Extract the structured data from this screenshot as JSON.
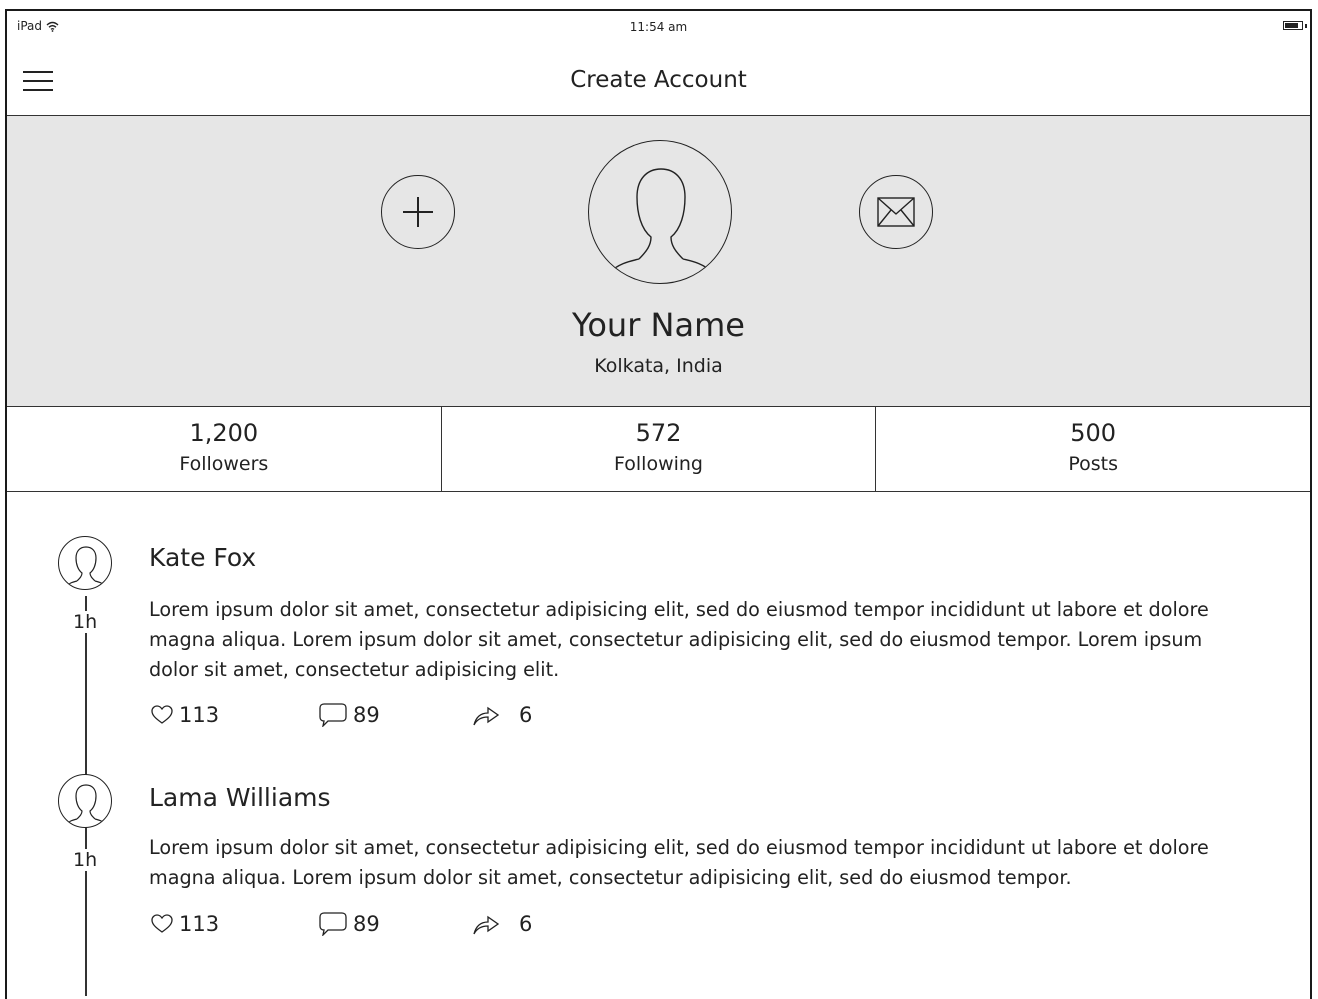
{
  "status_bar": {
    "device": "iPad",
    "time": "11:54 am"
  },
  "nav": {
    "title": "Create Account"
  },
  "profile": {
    "name": "Your Name",
    "location": "Kolkata, India"
  },
  "stats": [
    {
      "value": "1,200",
      "label": "Followers"
    },
    {
      "value": "572",
      "label": "Following"
    },
    {
      "value": "500",
      "label": "Posts"
    }
  ],
  "posts": [
    {
      "name": "Kate Fox",
      "time": "1h",
      "body": "Lorem ipsum dolor sit amet, consectetur adipisicing elit, sed do eiusmod tempor incididunt ut labore et dolore magna aliqua. Lorem ipsum dolor sit amet, consectetur adipisicing elit, sed do eiusmod tempor. Lorem ipsum dolor sit amet, consectetur adipisicing elit.",
      "likes": "113",
      "comments": "89",
      "shares": "6"
    },
    {
      "name": "Lama Williams",
      "time": "1h",
      "body": "Lorem ipsum dolor sit amet, consectetur adipisicing elit, sed do eiusmod tempor incididunt ut labore et dolore magna aliqua. Lorem ipsum dolor sit amet, consectetur adipisicing elit, sed do eiusmod tempor.",
      "likes": "113",
      "comments": "89",
      "shares": "6"
    }
  ],
  "icons": {
    "menu": "hamburger-icon",
    "add": "plus-icon",
    "message": "envelope-icon",
    "like": "heart-icon",
    "comment": "comment-icon",
    "share": "share-icon",
    "wifi": "wifi-icon",
    "battery": "battery-icon"
  },
  "battery_level": 0.7
}
